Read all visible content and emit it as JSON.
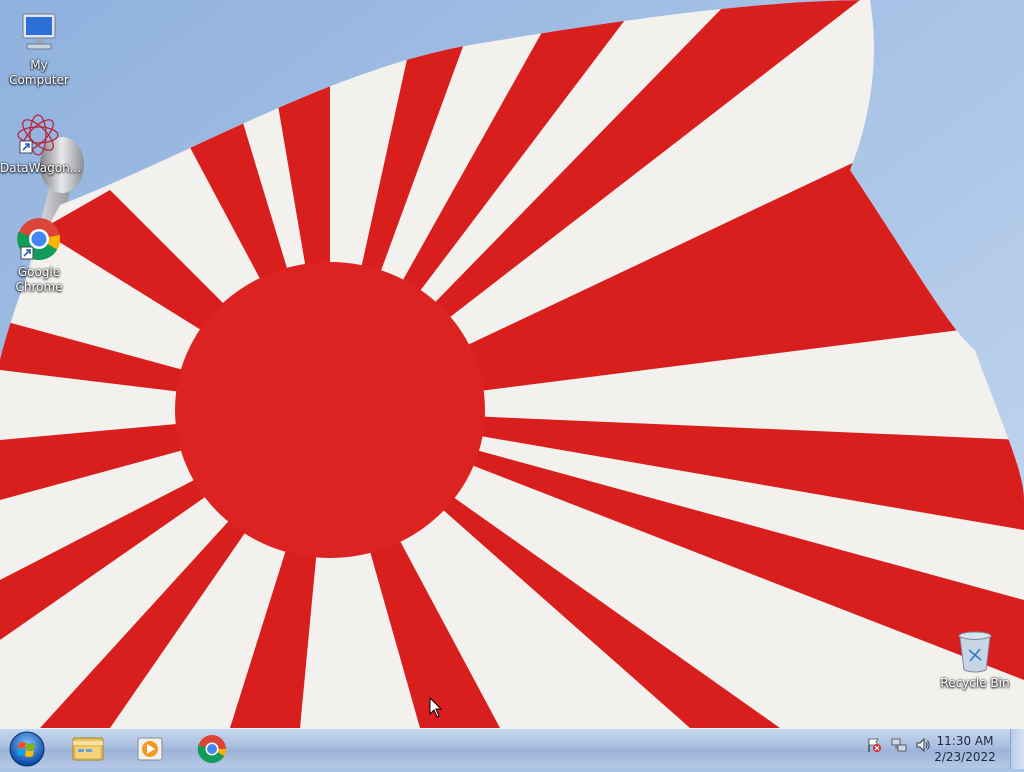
{
  "desktop": {
    "icons": [
      {
        "label": "My Computer",
        "icon": "computer-icon"
      },
      {
        "label": "DataWagon...",
        "icon": "datawagon-icon"
      },
      {
        "label": "Google Chrome",
        "icon": "chrome-icon"
      },
      {
        "label": "Recycle Bin",
        "icon": "recycle-bin-icon"
      }
    ],
    "colors": {
      "flag_red": "#d91e1e",
      "flag_white": "#f3f1ee",
      "sky": "#a9c3e6"
    }
  },
  "taskbar": {
    "start_icon": "windows-orb-icon",
    "pinned": [
      {
        "icon": "file-explorer-icon"
      },
      {
        "icon": "media-player-icon"
      },
      {
        "icon": "chrome-icon"
      }
    ],
    "tray": [
      {
        "icon": "action-center-flag-icon"
      },
      {
        "icon": "network-icon"
      },
      {
        "icon": "volume-icon"
      }
    ],
    "clock_time": "11:30 AM",
    "clock_date": "2/23/2022"
  }
}
